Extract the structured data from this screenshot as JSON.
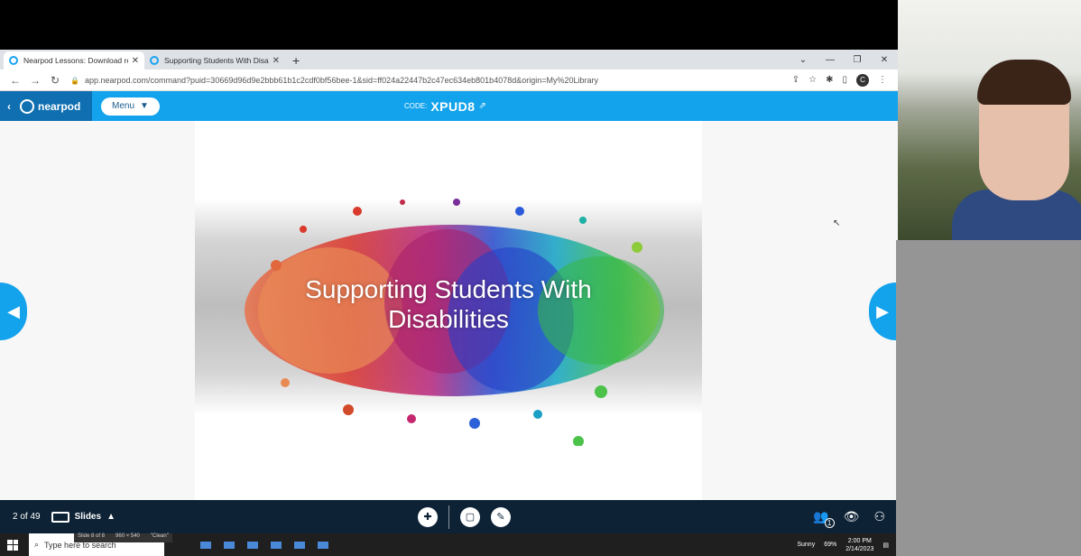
{
  "browser": {
    "tabs": [
      {
        "title": "Nearpod Lessons: Download rea",
        "active": true
      },
      {
        "title": "Supporting Students With Disab",
        "active": false
      }
    ],
    "new_tab": "+",
    "window_controls": {
      "minimize": "—",
      "maximize": "❐",
      "close": "✕",
      "chevron": "⌄"
    },
    "url": "app.nearpod.com/command?puid=30669d96d9e2bbb61b1c2cdf0bf56bee-1&sid=ff024a22447b2c47ec634eb801b4078d&origin=My%20Library",
    "profile_initial": "C"
  },
  "nearpod": {
    "logo_text": "nearpod",
    "menu_label": "Menu",
    "code_label": "CODE:",
    "code_value": "XPUD8"
  },
  "slide": {
    "title_line1": "Supporting Students With",
    "title_line2": "Disabilities"
  },
  "bottombar": {
    "slide_count": "2 of 49",
    "slides_label": "Slides",
    "participants_count": "1"
  },
  "taskbar": {
    "search_placeholder": "Type here to search",
    "statusline_slide": "Slide 8 of 8",
    "statusline_size": "960 × 540",
    "statusline_theme": "\"Clean\"",
    "weather": "Sunny",
    "zoom": "69%",
    "time": "2:00 PM",
    "date": "2/14/2023"
  },
  "colors": {
    "nearpod_blue": "#12a3ec",
    "nearpod_dark": "#0f6fb0",
    "bottombar": "#0d2235"
  }
}
